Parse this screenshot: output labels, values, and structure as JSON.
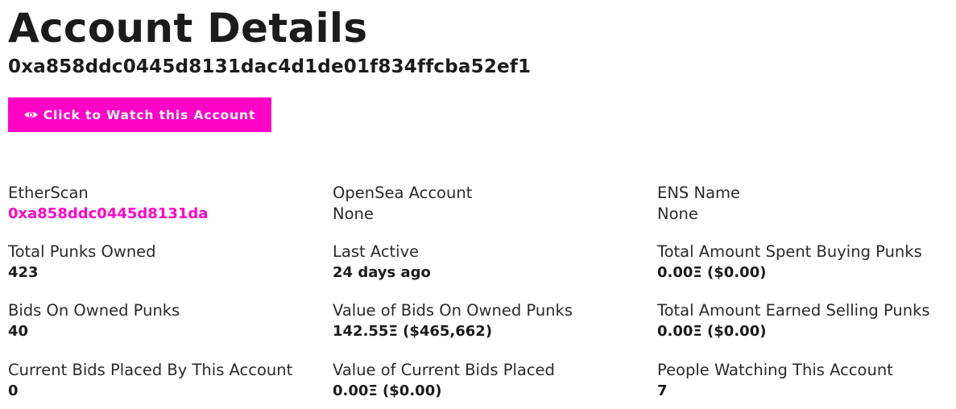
{
  "page": {
    "title": "Account Details",
    "address": "0xa858ddc0445d8131dac4d1de01f834ffcba52ef1"
  },
  "watch_button": {
    "label": "Click to Watch this Account",
    "icon": "eye-icon",
    "color": "#ff04c7"
  },
  "details": {
    "etherscan": {
      "label": "EtherScan",
      "value": "0xa858ddc0445d8131da"
    },
    "opensea": {
      "label": "OpenSea Account",
      "value": "None"
    },
    "ens": {
      "label": "ENS Name",
      "value": "None"
    },
    "total_punks_owned": {
      "label": "Total Punks Owned",
      "value": "423"
    },
    "last_active": {
      "label": "Last Active",
      "value": "24 days ago"
    },
    "total_spent": {
      "label": "Total Amount Spent Buying Punks",
      "value": "0.00Ξ ($0.00)"
    },
    "bids_on_owned": {
      "label": "Bids On Owned Punks",
      "value": "40"
    },
    "value_bids_on_owned": {
      "label": "Value of Bids On Owned Punks",
      "value": "142.55Ξ ($465,662)"
    },
    "total_earned": {
      "label": "Total Amount Earned Selling Punks",
      "value": "0.00Ξ ($0.00)"
    },
    "current_bids_placed": {
      "label": "Current Bids Placed By This Account",
      "value": "0"
    },
    "value_current_bids": {
      "label": "Value of Current Bids Placed",
      "value": "0.00Ξ ($0.00)"
    },
    "people_watching": {
      "label": "People Watching This Account",
      "value": "7"
    }
  },
  "colors": {
    "accent": "#ff04c7",
    "text": "#1b1b1b",
    "background": "#ffffff"
  }
}
